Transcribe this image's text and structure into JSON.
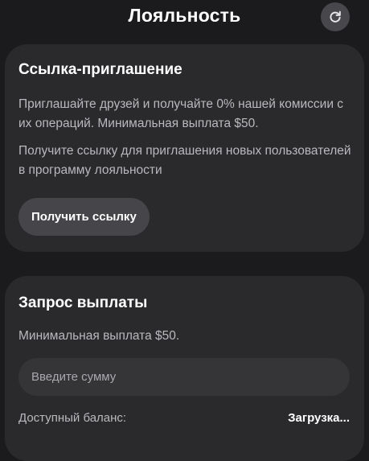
{
  "header": {
    "title": "Лояльность",
    "refresh_icon": "refresh-icon"
  },
  "invite_card": {
    "title": "Ссылка-приглашение",
    "description": "Приглашайте друзей и получайте 0% нашей комиссии с их операций. Минимальная выплата $50.",
    "hint": "Получите ссылку для приглашения новых пользователей в программу лояльности",
    "button_label": "Получить ссылку"
  },
  "payout_card": {
    "title": "Запрос выплаты",
    "min_payout": "Минимальная выплата $50.",
    "amount_placeholder": "Введите сумму",
    "balance_label": "Доступный баланс:",
    "balance_value": "Загрузка..."
  },
  "colors": {
    "background": "#1b1b1d",
    "card": "#2a2a2d",
    "button": "#46464a",
    "input": "#353538",
    "text_primary": "#ffffff",
    "text_secondary": "#b9b9be"
  }
}
